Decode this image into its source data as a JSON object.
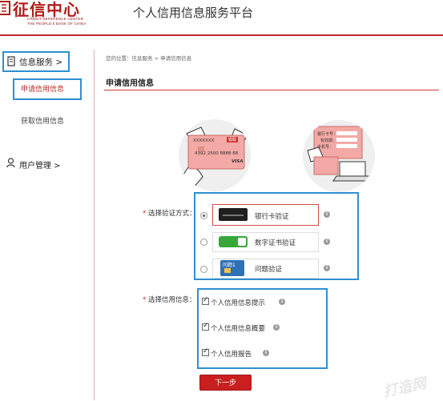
{
  "header": {
    "logo_cn": "征信中心",
    "logo_en_line1": "CREDIT REFERENCE CENTER",
    "logo_en_line2": "THE PEOPLE'S BANK OF CHINA",
    "site_title": "个人信用信息服务平台",
    "brand_color": "#c32a2a"
  },
  "sidebar": {
    "info_services": "信息服务 >",
    "apply_credit": "申请信用信息",
    "get_credit": "获取信用信息",
    "user_management": "用户管理 >"
  },
  "main": {
    "breadcrumb": "您的位置：信息服务 > 申请信用信息",
    "section_title": "申请信用信息",
    "card_illustration": {
      "card_brand": "XXXXXXX",
      "card_tag": "银联",
      "card_number": "4392 2500 8888 88",
      "card_network": "VISA"
    },
    "online_illustration": {
      "field1": "银行卡号：",
      "field2": "有效期：",
      "field3": "手机号："
    },
    "verify": {
      "required_mark": "*",
      "label": "选择验证方式：",
      "options": [
        {
          "label": "银行卡验证",
          "selected": true
        },
        {
          "label": "数字证书验证",
          "selected": false
        },
        {
          "label": "问题验证",
          "selected": false,
          "icon_text": "问题1"
        }
      ]
    },
    "credit": {
      "required_mark": "*",
      "label": "选择信用信息：",
      "items": [
        {
          "label": "个人信用信息提示",
          "checked": true
        },
        {
          "label": "个人信用信息概要",
          "checked": true
        },
        {
          "label": "个人信用报告",
          "checked": true
        }
      ]
    },
    "next_button": "下一步",
    "info_glyph": "i"
  },
  "watermark": "打造网"
}
